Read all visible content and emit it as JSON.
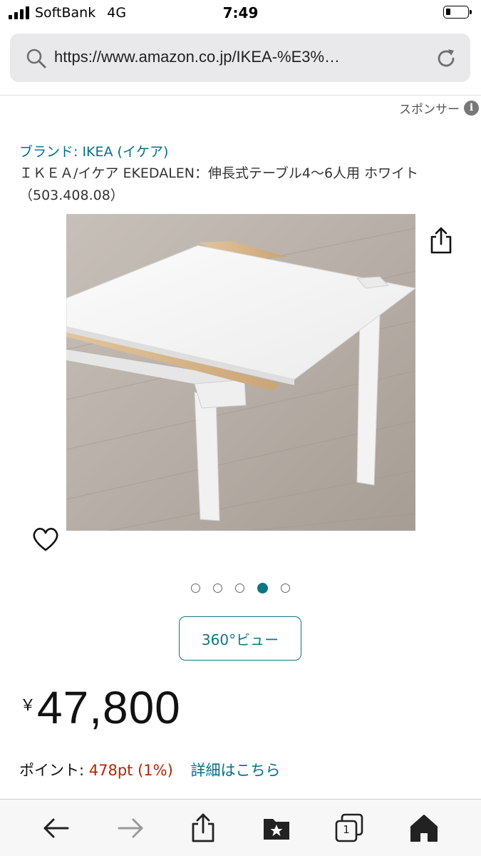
{
  "status_bar": {
    "carrier": "SoftBank",
    "network": "4G",
    "time": "7:49"
  },
  "browser": {
    "url": "https://www.amazon.co.jp/IKEA-%E3%…",
    "icons": [
      "search-icon",
      "reload-icon"
    ]
  },
  "sponsor": {
    "label": "スポンサー",
    "info_icon": "i"
  },
  "product": {
    "brand": "ブランド: IKEA (イケア)",
    "title": "ＩＫＥＡ/イケア EKEDALEN：伸長式テーブル4〜6人用 ホワイト （503.408.08）",
    "image_count": 5,
    "active_image_index": 3,
    "view360_label": "360°ビュー",
    "price_currency": "￥",
    "price_amount": "47,800"
  },
  "points": {
    "label": "ポイント: ",
    "value": "478pt  (1%)",
    "link": "詳細はこちら"
  },
  "toolbar": {
    "tabs_count": "1",
    "icons": [
      "back-arrow-icon",
      "forward-arrow-icon",
      "share-icon",
      "bookmarks-icon",
      "tabs-icon",
      "home-icon"
    ]
  },
  "colors": {
    "link": "#007185",
    "accent": "#0f7583",
    "price_red": "#b12704"
  }
}
